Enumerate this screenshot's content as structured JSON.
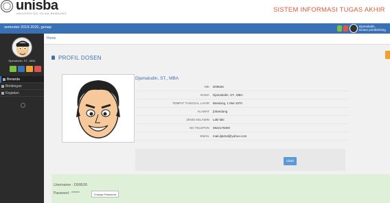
{
  "header": {
    "logo_text": "unisba",
    "logo_sub": "UNIVERSITAS ISLAM BANDUNG",
    "system_title": "SISTEM INFORMASI TUGAS AKHIR"
  },
  "navbar": {
    "period_text": "semester 2019-2020, genap",
    "user_name": "Djamaludin,",
    "user_role": "Dosen pembimbing"
  },
  "sidebar": {
    "user_label": "Djamaludin, ST., MBA",
    "menu": [
      {
        "label": "Beranda"
      },
      {
        "label": "Bimbingan"
      },
      {
        "label": "Kegiatan"
      }
    ]
  },
  "breadcrumb": {
    "home": "Home"
  },
  "profile": {
    "title": "PROFIL DOSEN",
    "name": "Djamaludin, ST., MBA",
    "fields": [
      {
        "label": "NIK",
        "value": "D09526"
      },
      {
        "label": "NAMA",
        "value": "Djamaludin, ST., MBA"
      },
      {
        "label": "TEMPAT TANGGAL LAHIR",
        "value": "Bandung, 1 Mei 1970"
      },
      {
        "label": "ALAMAT",
        "value": "jl.Bandung"
      },
      {
        "label": "JENIS KELAMIN",
        "value": "Laki-laki"
      },
      {
        "label": "NO TELEPON",
        "value": "0822176000"
      },
      {
        "label": "EMAIL",
        "value": "mail.djamal@yahoo.com"
      }
    ],
    "edit_button": "Ubah"
  },
  "login": {
    "username_label": "Username : D09526",
    "password_label": "Password : ******",
    "change_pw_button": "Change Password"
  }
}
